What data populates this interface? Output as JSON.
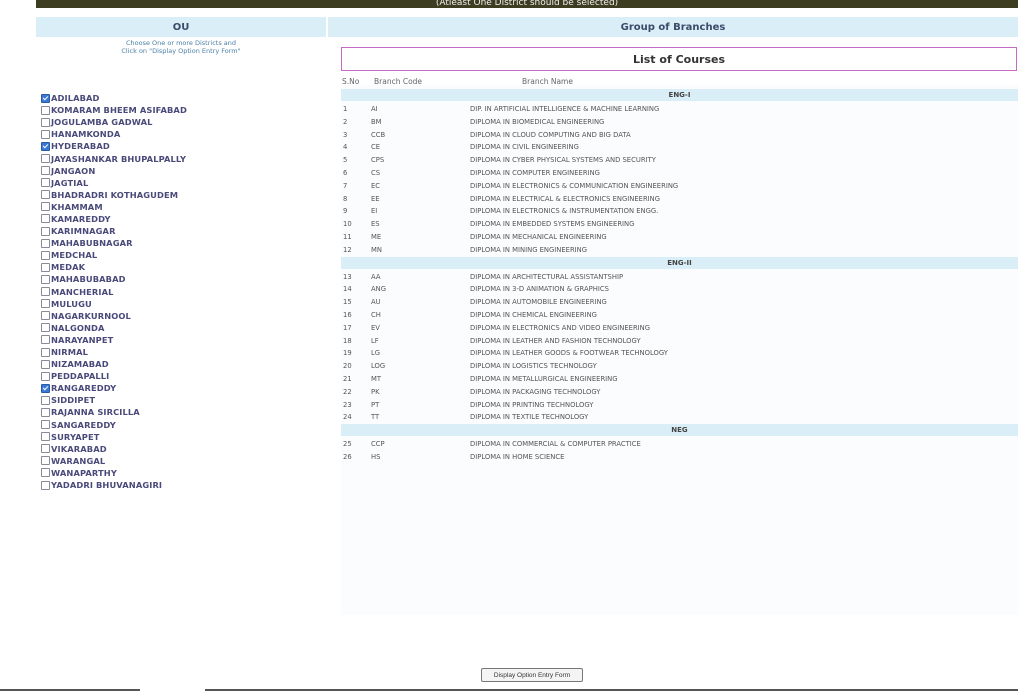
{
  "banner": "(Atleast One District should be selected)",
  "headers": {
    "ou": "OU",
    "group": "Group of Branches"
  },
  "note": [
    "Choose One or more Districts and",
    "Click on \"Display Option Entry Form\""
  ],
  "districts": [
    {
      "name": "ADILABAD",
      "checked": true
    },
    {
      "name": "KOMARAM BHEEM ASIFABAD",
      "checked": false
    },
    {
      "name": "JOGULAMBA GADWAL",
      "checked": false
    },
    {
      "name": "HANAMKONDA",
      "checked": false
    },
    {
      "name": "HYDERABAD",
      "checked": true
    },
    {
      "name": "JAYASHANKAR BHUPALPALLY",
      "checked": false
    },
    {
      "name": "JANGAON",
      "checked": false
    },
    {
      "name": "JAGTIAL",
      "checked": false
    },
    {
      "name": "BHADRADRI KOTHAGUDEM",
      "checked": false
    },
    {
      "name": "KHAMMAM",
      "checked": false
    },
    {
      "name": "KAMAREDDY",
      "checked": false
    },
    {
      "name": "KARIMNAGAR",
      "checked": false
    },
    {
      "name": "MAHABUBNAGAR",
      "checked": false
    },
    {
      "name": "MEDCHAL",
      "checked": false
    },
    {
      "name": "MEDAK",
      "checked": false
    },
    {
      "name": "MAHABUBABAD",
      "checked": false
    },
    {
      "name": "MANCHERIAL",
      "checked": false
    },
    {
      "name": "MULUGU",
      "checked": false
    },
    {
      "name": "NAGARKURNOOL",
      "checked": false
    },
    {
      "name": "NALGONDA",
      "checked": false
    },
    {
      "name": "NARAYANPET",
      "checked": false
    },
    {
      "name": "NIRMAL",
      "checked": false
    },
    {
      "name": "NIZAMABAD",
      "checked": false
    },
    {
      "name": "PEDDAPALLI",
      "checked": false
    },
    {
      "name": "RANGAREDDY",
      "checked": true
    },
    {
      "name": "SIDDIPET",
      "checked": false
    },
    {
      "name": "RAJANNA SIRCILLA",
      "checked": false
    },
    {
      "name": "SANGAREDDY",
      "checked": false
    },
    {
      "name": "SURYAPET",
      "checked": false
    },
    {
      "name": "VIKARABAD",
      "checked": false
    },
    {
      "name": "WARANGAL",
      "checked": false
    },
    {
      "name": "WANAPARTHY",
      "checked": false
    },
    {
      "name": "YADADRI BHUVANAGIRI",
      "checked": false
    }
  ],
  "courses": {
    "title": "List of Courses",
    "columns": [
      "S.No",
      "Branch Code",
      "Branch Name"
    ],
    "groups": [
      {
        "name": "ENG-I",
        "rows": [
          [
            "1",
            "AI",
            "DIP. IN ARTIFICIAL INTELLIGENCE & MACHINE LEARNING"
          ],
          [
            "2",
            "BM",
            "DIPLOMA IN BIOMEDICAL ENGINEERING"
          ],
          [
            "3",
            "CCB",
            "DIPLOMA IN CLOUD COMPUTING AND BIG DATA"
          ],
          [
            "4",
            "CE",
            "DIPLOMA IN CIVIL ENGINEERING"
          ],
          [
            "5",
            "CPS",
            "DIPLOMA IN CYBER PHYSICAL SYSTEMS AND SECURITY"
          ],
          [
            "6",
            "CS",
            "DIPLOMA IN COMPUTER ENGINEERING"
          ],
          [
            "7",
            "EC",
            "DIPLOMA IN ELECTRONICS & COMMUNICATION ENGINEERING"
          ],
          [
            "8",
            "EE",
            "DIPLOMA IN ELECTRICAL & ELECTRONICS ENGINEERING"
          ],
          [
            "9",
            "EI",
            "DIPLOMA IN ELECTRONICS & INSTRUMENTATION ENGG."
          ],
          [
            "10",
            "ES",
            "DIPLOMA IN EMBEDDED SYSTEMS ENGINEERING"
          ],
          [
            "11",
            "ME",
            "DIPLOMA IN MECHANICAL ENGINEERING"
          ],
          [
            "12",
            "MN",
            "DIPLOMA IN MINING ENGINEERING"
          ]
        ]
      },
      {
        "name": "ENG-II",
        "rows": [
          [
            "13",
            "AA",
            "DIPLOMA IN ARCHITECTURAL ASSISTANTSHIP"
          ],
          [
            "14",
            "ANG",
            "DIPLOMA IN 3-D ANIMATION & GRAPHICS"
          ],
          [
            "15",
            "AU",
            "DIPLOMA IN AUTOMOBILE ENGINEERING"
          ],
          [
            "16",
            "CH",
            "DIPLOMA IN CHEMICAL ENGINEERING"
          ],
          [
            "17",
            "EV",
            "DIPLOMA IN ELECTRONICS AND VIDEO ENGINEERING"
          ],
          [
            "18",
            "LF",
            "DIPLOMA IN LEATHER AND FASHION TECHNOLOGY"
          ],
          [
            "19",
            "LG",
            "DIPLOMA IN LEATHER GOODS & FOOTWEAR TECHNOLOGY"
          ],
          [
            "20",
            "LOG",
            "DIPLOMA IN LOGISTICS TECHNOLOGY"
          ],
          [
            "21",
            "MT",
            "DIPLOMA IN METALLURGICAL ENGINEERING"
          ],
          [
            "22",
            "PK",
            "DIPLOMA IN PACKAGING TECHNOLOGY"
          ],
          [
            "23",
            "PT",
            "DIPLOMA IN PRINTING TECHNOLOGY"
          ],
          [
            "24",
            "TT",
            "DIPLOMA IN TEXTILE TECHNOLOGY"
          ]
        ]
      },
      {
        "name": "NEG",
        "rows": [
          [
            "25",
            "CCP",
            "DIPLOMA IN COMMERCIAL & COMPUTER PRACTICE"
          ],
          [
            "26",
            "HS",
            "DIPLOMA IN HOME SCIENCE"
          ]
        ]
      }
    ]
  },
  "button": "Display Option Entry Form"
}
